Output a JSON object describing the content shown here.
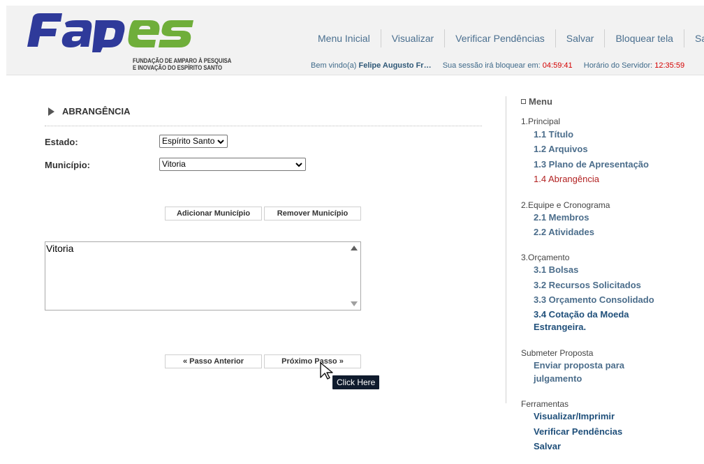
{
  "logo": {
    "text": "FAPES",
    "subtitle_line1": "FUNDAÇÃO DE AMPARO À PESQUISA",
    "subtitle_line2": "E INOVAÇÃO DO ESPÍRITO SANTO"
  },
  "nav": {
    "items": [
      "Menu Inicial",
      "Visualizar",
      "Verificar Pendências",
      "Salvar",
      "Bloquear tela",
      "Sair"
    ]
  },
  "status": {
    "welcome_label": "Bem vindo(a)",
    "user_name": "Felipe Augusto Fr…",
    "session_label": "Sua sessão irá bloquear em:",
    "session_time": "04:59:41",
    "server_label": "Horário do Servidor:",
    "server_time": "12:35:59"
  },
  "main": {
    "section_title": "ABRANGÊNCIA",
    "estado_label": "Estado:",
    "estado_value": "Espírito Santo",
    "municipio_label": "Município:",
    "municipio_value": "Vitoria",
    "add_button": "Adicionar Município",
    "remove_button": "Remover Município",
    "selected_list": [
      "Vitoria"
    ],
    "prev_button": "« Passo Anterior",
    "next_button": "Próximo Passo »",
    "tooltip": "Click Here"
  },
  "sidebar": {
    "menu_title": "Menu",
    "groups": [
      {
        "title": "1.Principal",
        "items": [
          "1.1 Título",
          "1.2 Arquivos",
          "1.3 Plano de Apresentação",
          "1.4 Abrangência"
        ]
      },
      {
        "title": "2.Equipe e Cronograma",
        "items": [
          "2.1 Membros",
          "2.2 Atividades"
        ]
      },
      {
        "title": "3.Orçamento",
        "items": [
          "3.1 Bolsas",
          "3.2 Recursos Solicitados",
          "3.3 Orçamento Consolidado",
          "3.4 Cotação da Moeda",
          "Estrangeira."
        ]
      },
      {
        "title": "Submeter Proposta",
        "items": [
          "Enviar proposta para",
          "julgamento"
        ]
      },
      {
        "title": "Ferramentas",
        "items": [
          "Visualizar/Imprimir",
          "Verificar Pendências",
          "Salvar"
        ]
      }
    ]
  },
  "colors": {
    "nav_link": "#4a6f8f",
    "sidebar_link": "#4b6d8b",
    "active_link": "#b22222",
    "logo_blue": "#2f3a9a",
    "logo_green": "#6fae3a",
    "timer_red": "#d40000"
  }
}
